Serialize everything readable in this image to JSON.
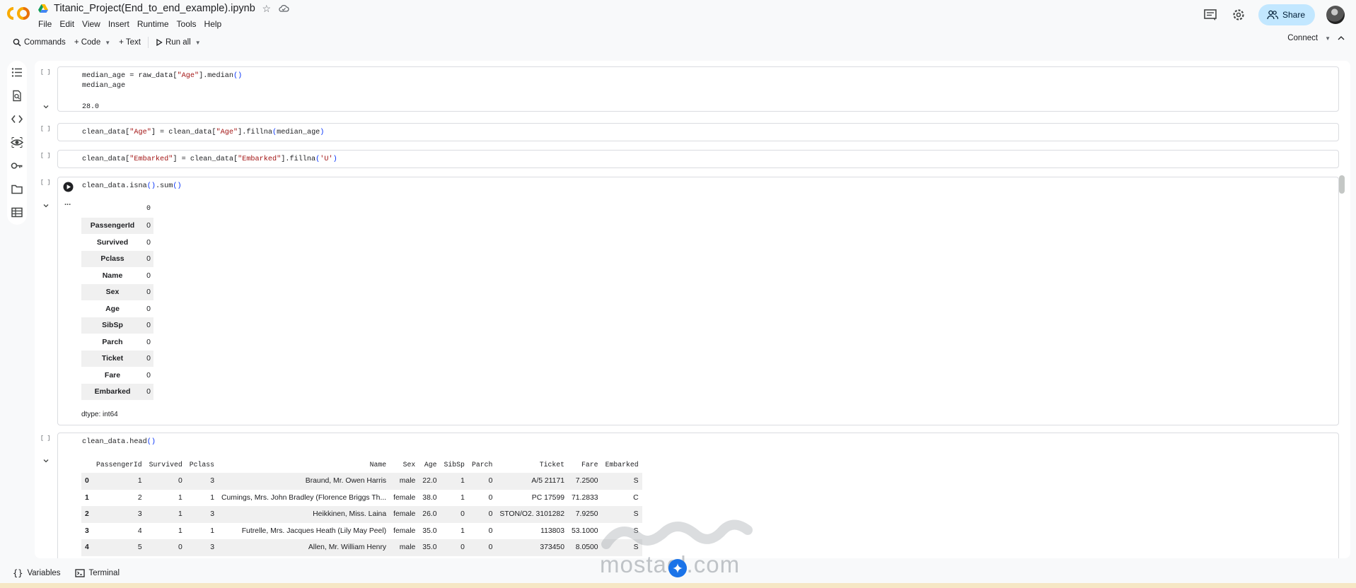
{
  "header": {
    "notebook_title": "Titanic_Project(End_to_end_example).ipynb",
    "menu": [
      "File",
      "Edit",
      "View",
      "Insert",
      "Runtime",
      "Tools",
      "Help"
    ],
    "share_label": "Share",
    "icons": [
      "comment-icon",
      "settings-icon",
      "share-people-icon",
      "avatar"
    ]
  },
  "toolbar": {
    "commands_label": "Commands",
    "code_label": "+ Code",
    "text_label": "+ Text",
    "run_all_label": "Run all",
    "connect_label": "Connect"
  },
  "sidebar": {
    "icons": [
      "toc-icon",
      "find-icon",
      "code-snippets-icon",
      "variables-inspector-icon",
      "secrets-key-icon",
      "files-folder-icon",
      "data-table-icon"
    ]
  },
  "cells": [
    {
      "exec": "[ ]",
      "code_lines": [
        "median_age = raw_data[\"Age\"].median()",
        "median_age"
      ],
      "output": "28.0"
    },
    {
      "exec": "[ ]",
      "code": "clean_data[\"Age\"] = clean_data[\"Age\"].fillna(median_age)"
    },
    {
      "exec": "[ ]",
      "code": "clean_data[\"Embarked\"] = clean_data[\"Embarked\"].fillna('U')"
    },
    {
      "exec": "[ ]",
      "code": "clean_data.isna().sum()",
      "output_ellipsis": "..."
    },
    {
      "exec": "[ ]",
      "code": "clean_data.head()"
    }
  ],
  "isna_output": {
    "header": "0",
    "rows": [
      {
        "label": "PassengerId",
        "value": "0"
      },
      {
        "label": "Survived",
        "value": "0"
      },
      {
        "label": "Pclass",
        "value": "0"
      },
      {
        "label": "Name",
        "value": "0"
      },
      {
        "label": "Sex",
        "value": "0"
      },
      {
        "label": "Age",
        "value": "0"
      },
      {
        "label": "SibSp",
        "value": "0"
      },
      {
        "label": "Parch",
        "value": "0"
      },
      {
        "label": "Ticket",
        "value": "0"
      },
      {
        "label": "Fare",
        "value": "0"
      },
      {
        "label": "Embarked",
        "value": "0"
      }
    ],
    "dtype": "dtype: int64"
  },
  "head_output": {
    "columns": [
      "",
      "PassengerId",
      "Survived",
      "Pclass",
      "Name",
      "Sex",
      "Age",
      "SibSp",
      "Parch",
      "Ticket",
      "Fare",
      "Embarked"
    ],
    "rows": [
      [
        "0",
        "1",
        "0",
        "3",
        "Braund, Mr. Owen Harris",
        "male",
        "22.0",
        "1",
        "0",
        "A/5 21171",
        "7.2500",
        "S"
      ],
      [
        "1",
        "2",
        "1",
        "1",
        "Cumings, Mrs. John Bradley (Florence Briggs Th...",
        "female",
        "38.0",
        "1",
        "0",
        "PC 17599",
        "71.2833",
        "C"
      ],
      [
        "2",
        "3",
        "1",
        "3",
        "Heikkinen, Miss. Laina",
        "female",
        "26.0",
        "0",
        "0",
        "STON/O2. 3101282",
        "7.9250",
        "S"
      ],
      [
        "3",
        "4",
        "1",
        "1",
        "Futrelle, Mrs. Jacques Heath (Lily May Peel)",
        "female",
        "35.0",
        "1",
        "0",
        "113803",
        "53.1000",
        "S"
      ],
      [
        "4",
        "5",
        "0",
        "3",
        "Allen, Mr. William Henry",
        "male",
        "35.0",
        "0",
        "0",
        "373450",
        "8.0500",
        "S"
      ]
    ]
  },
  "watermark": {
    "url": "mostaql.com"
  },
  "statusbar": {
    "variables_label": "Variables",
    "terminal_label": "Terminal"
  },
  "colors": {
    "accent": "#1a73e8",
    "share_bg": "#c2e7ff",
    "string": "#a31515",
    "paren": "#0431fa",
    "bottom_strip": "#f6e7c5"
  }
}
